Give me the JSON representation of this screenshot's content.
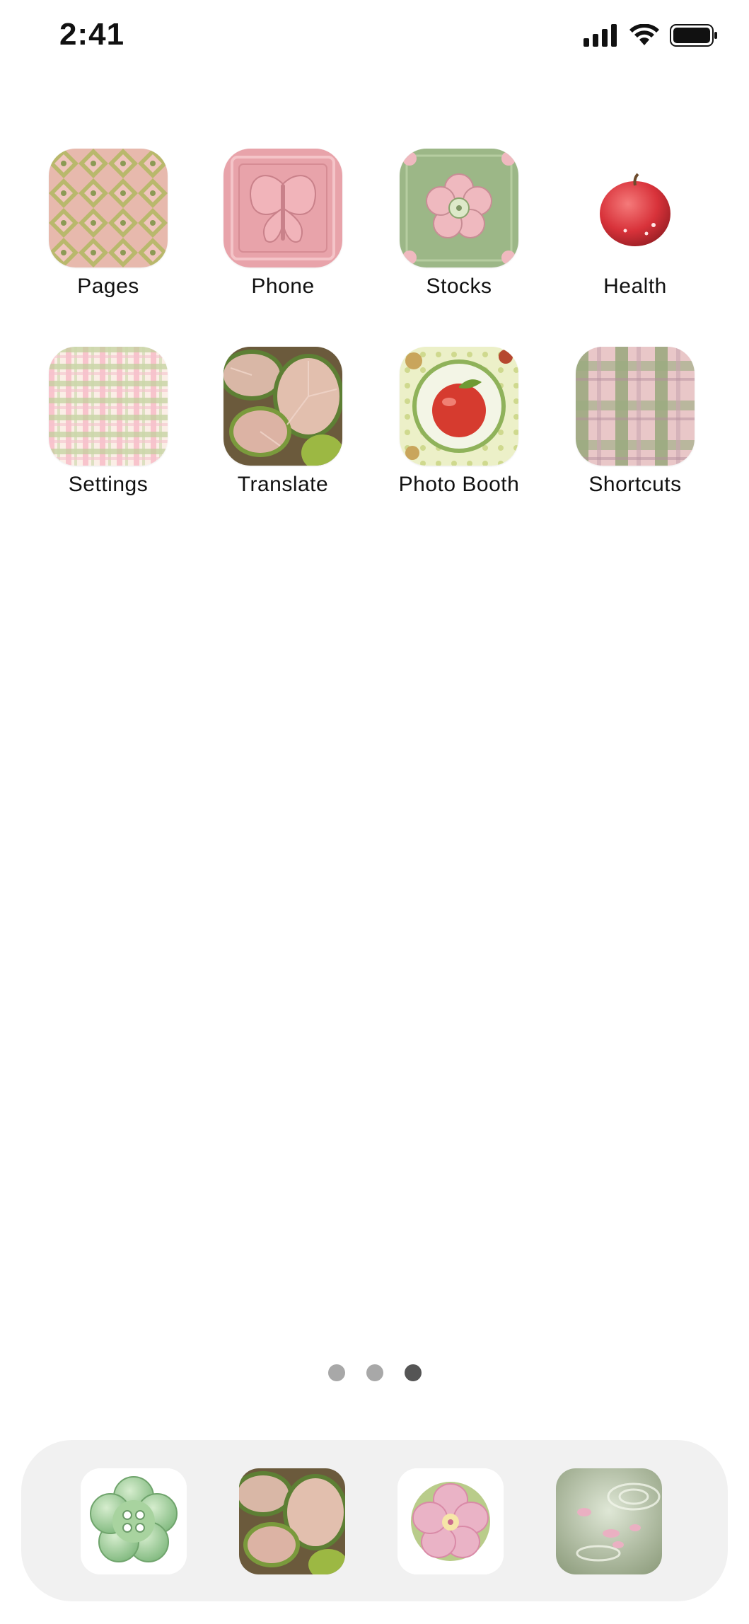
{
  "status_bar": {
    "time": "2:41",
    "icons": [
      "signal-icon",
      "wifi-icon",
      "battery-icon"
    ]
  },
  "apps": [
    {
      "label": "Pages",
      "icon": "pink-green-diamond-pattern-icon"
    },
    {
      "label": "Phone",
      "icon": "pink-butterfly-tile-icon"
    },
    {
      "label": "Stocks",
      "icon": "green-flower-tile-icon"
    },
    {
      "label": "Health",
      "icon": "red-apple-icon"
    },
    {
      "label": "Settings",
      "icon": "gingham-pattern-icon"
    },
    {
      "label": "Translate",
      "icon": "lime-slices-icon"
    },
    {
      "label": "Photo Booth",
      "icon": "apple-badge-icon"
    },
    {
      "label": "Shortcuts",
      "icon": "plaid-fabric-icon"
    }
  ],
  "page_dots": {
    "count": 3,
    "active_index": 2
  },
  "dock": [
    {
      "icon": "green-flower-button-icon"
    },
    {
      "icon": "lime-slices-icon"
    },
    {
      "icon": "pink-hibiscus-icon"
    },
    {
      "icon": "water-petals-icon"
    }
  ],
  "colors": {
    "pink": "#e9a8ad",
    "sage": "#9fb483",
    "dock_bg": "#f1f1f1",
    "active_dot": "#555555",
    "inactive_dot": "#a8a8a8"
  }
}
